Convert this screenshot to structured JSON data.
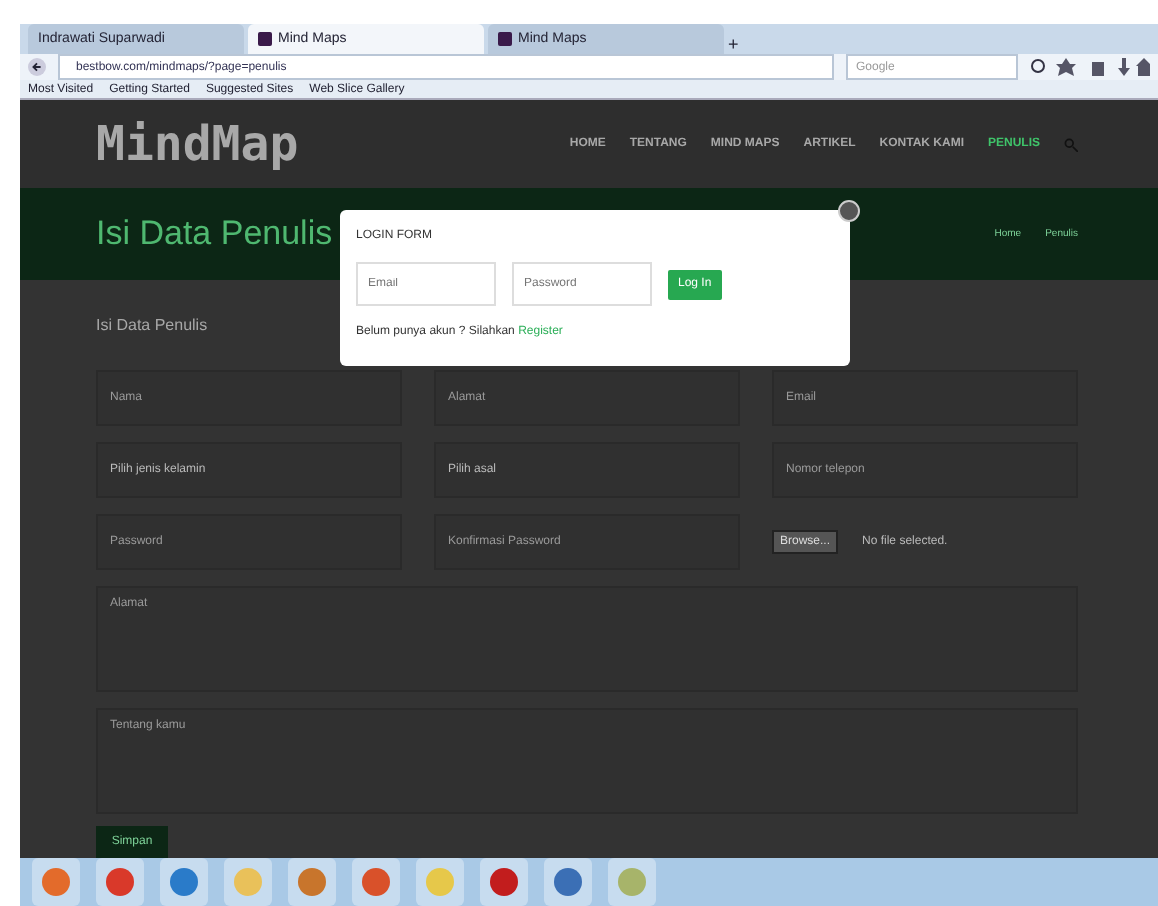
{
  "browser": {
    "tabs": [
      {
        "title": "Indrawati Suparwadi",
        "selected": false
      },
      {
        "title": "Mind Maps",
        "selected": true
      },
      {
        "title": "Mind Maps",
        "selected": false
      }
    ],
    "new_tab": "+",
    "url": "bestbow.com/mindmaps/?page=penulis",
    "search": {
      "placeholder": "Google"
    },
    "bookmarks": [
      "Most Visited",
      "Getting Started",
      "Suggested Sites",
      "Web Slice Gallery"
    ]
  },
  "site": {
    "logo": "MindMap",
    "nav": [
      {
        "label": "HOME",
        "selected": false
      },
      {
        "label": "TENTANG",
        "selected": false
      },
      {
        "label": "MIND MAPS",
        "selected": false
      },
      {
        "label": "ARTIKEL",
        "selected": false
      },
      {
        "label": "KONTAK KAMI",
        "selected": false
      },
      {
        "label": "PENULIS",
        "selected": true
      }
    ],
    "banner_title": "Isi Data Penulis",
    "breadcrumb": [
      "Home",
      "Penulis"
    ],
    "form_title": "Isi Data Penulis",
    "fields": [
      {
        "kind": "input",
        "placeholder": "Nama"
      },
      {
        "kind": "input",
        "placeholder": "Alamat"
      },
      {
        "kind": "input",
        "placeholder": "Email"
      },
      {
        "kind": "select",
        "value": "Pilih jenis kelamin"
      },
      {
        "kind": "select",
        "value": "Pilih asal"
      },
      {
        "kind": "input",
        "placeholder": "Nomor telepon"
      },
      {
        "kind": "input",
        "placeholder": "Password"
      },
      {
        "kind": "input",
        "placeholder": "Konfirmasi Password"
      },
      {
        "kind": "file",
        "button": "Browse...",
        "note": "No file selected."
      },
      {
        "kind": "textarea",
        "placeholder": "Alamat"
      },
      {
        "kind": "textarea",
        "placeholder": "Tentang kamu"
      }
    ],
    "submit": "Simpan"
  },
  "modal": {
    "title": "LOGIN FORM",
    "email": {
      "placeholder": "Email"
    },
    "password": {
      "placeholder": "Password"
    },
    "login": "Log In",
    "prompt": "Belum punya akun ? Silahkan ",
    "register": "Register"
  }
}
